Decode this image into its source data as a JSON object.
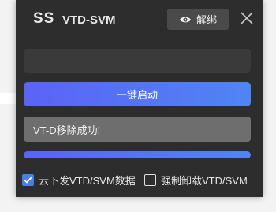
{
  "header": {
    "logo_text": "SS",
    "title": "VTD-SVM",
    "unbind_label": "解绑",
    "unbind_icon": "eye-icon",
    "close_icon": "close-icon"
  },
  "input": {
    "value": "",
    "placeholder": ""
  },
  "main": {
    "start_label": "一键启动",
    "status_text": "VT-D移除成功!",
    "progress_percent": 100
  },
  "options": [
    {
      "label": "云下发VTD/SVM数据",
      "checked": true
    },
    {
      "label": "强制卸载VTD/SVM",
      "checked": false
    }
  ],
  "colors": {
    "window_bg": "#2d2d2d",
    "accent_start": "#5b63f5",
    "accent_end": "#4f85f3",
    "checkbox_checked": "#4b7de6"
  }
}
